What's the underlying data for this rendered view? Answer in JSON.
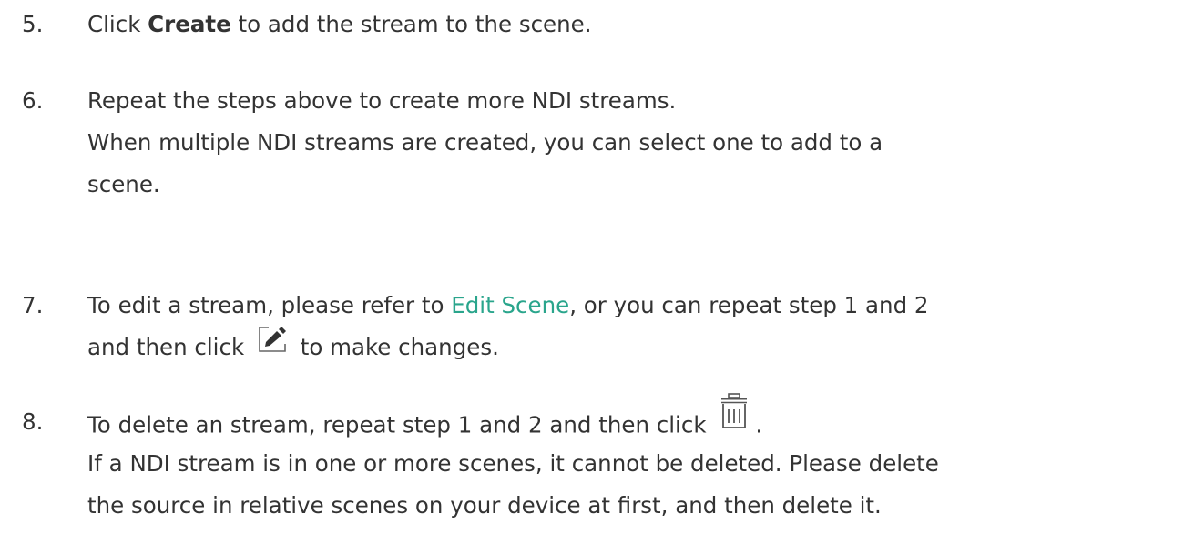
{
  "steps": [
    {
      "number": "5.",
      "lines": [
        {
          "pre": "Click ",
          "bold": "Create",
          "post": " to add the stream to the scene."
        }
      ]
    },
    {
      "number": "6.",
      "lines": [
        "Repeat the steps above to create more NDI streams.",
        "When multiple NDI streams are created, you can select one to add to a",
        "scene."
      ]
    },
    {
      "number": "7.",
      "line1": {
        "pre": "To edit a stream, please refer to ",
        "link": "Edit Scene",
        "post": ", or you can repeat step 1 and 2"
      },
      "line2": {
        "pre": "and then click ",
        "post": " to make changes."
      },
      "icon": "edit-icon"
    },
    {
      "number": "8.",
      "line1": {
        "pre": "To delete an stream, repeat step 1 and 2 and then click ",
        "post": "."
      },
      "lines": [
        "If a NDI stream is in one or more scenes, it cannot be deleted. Please delete",
        "the source in relative scenes on your device at first, and then delete it."
      ],
      "icon": "trash-icon"
    }
  ],
  "colors": {
    "text": "#333333",
    "link": "#2aa58c"
  }
}
